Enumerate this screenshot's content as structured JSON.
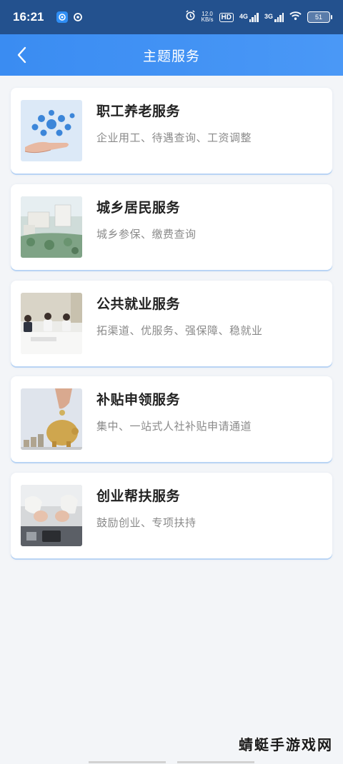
{
  "status_bar": {
    "time": "16:21",
    "net_speed_value": "12.0",
    "net_speed_unit": "KB/s",
    "hd_label": "HD",
    "sim1_label": "4G",
    "sim2_label": "3G",
    "battery": "51"
  },
  "header": {
    "title": "主题服务",
    "accent_color": "#3a8cf2"
  },
  "services": [
    {
      "title": "职工养老服务",
      "desc": "企业用工、待遇查询、工资调整"
    },
    {
      "title": "城乡居民服务",
      "desc": "城乡参保、缴费查询"
    },
    {
      "title": "公共就业服务",
      "desc": "拓渠道、优服务、强保障、稳就业"
    },
    {
      "title": "补贴申领服务",
      "desc": "集中、一站式人社补贴申请通道"
    },
    {
      "title": "创业帮扶服务",
      "desc": "鼓励创业、专项扶持"
    }
  ],
  "watermark": "蜻蜓手游戏网"
}
